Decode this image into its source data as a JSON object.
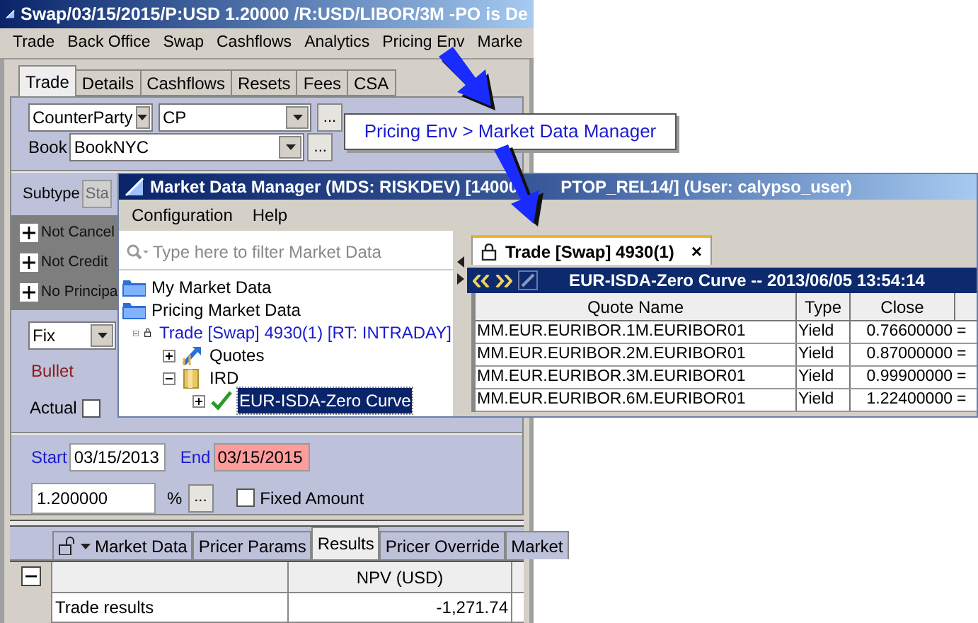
{
  "main_window": {
    "title": "Swap/03/15/2015/P:USD 1.20000 /R:USD/LIBOR/3M  -PO is De",
    "menu": [
      "Trade",
      "Back Office",
      "Swap",
      "Cashflows",
      "Analytics",
      "Pricing Env",
      "Marke"
    ],
    "tabs": [
      {
        "label": "Trade",
        "selected": true
      },
      {
        "label": "Details",
        "selected": false
      },
      {
        "label": "Cashflows",
        "selected": false
      },
      {
        "label": "Resets",
        "selected": false
      },
      {
        "label": "Fees",
        "selected": false
      },
      {
        "label": "CSA",
        "selected": false
      }
    ],
    "counterparty": {
      "role": "CounterParty",
      "value": "CP",
      "button": "..."
    },
    "book": {
      "label": "Book",
      "value": "BookNYC",
      "button": "..."
    },
    "subtype": {
      "label": "Subtype",
      "value": "Sta",
      "disabled": true
    },
    "flags": [
      "Not Cancel",
      "Not Credit",
      "No Principa"
    ],
    "leg_type": "Fix",
    "amortization": "Bullet",
    "actual": {
      "label": "Actual",
      "checked": false
    },
    "start": {
      "label": "Start",
      "value": "03/15/2013",
      "highlighted": false
    },
    "end": {
      "label": "End",
      "value": "03/15/2015",
      "highlighted": true
    },
    "rate": {
      "value": "1.200000",
      "unit": "%",
      "button": "..."
    },
    "fixed_amount": {
      "label": "Fixed Amount",
      "checked": false
    },
    "pricer_tabs": [
      {
        "label": "Market Data",
        "kind": "dropdown",
        "selected": false
      },
      {
        "label": "Pricer Params",
        "kind": "tab",
        "selected": false
      },
      {
        "label": "Results",
        "kind": "tab",
        "selected": true
      },
      {
        "label": "Pricer Override",
        "kind": "tab",
        "selected": false
      },
      {
        "label": "Market",
        "kind": "tab",
        "selected": false
      }
    ],
    "results": {
      "columns": [
        "NPV (USD)"
      ],
      "rows": [
        {
          "label": "Trade results",
          "values": [
            "-1,271.74"
          ]
        }
      ]
    }
  },
  "callout": {
    "text": "Pricing Env > Market Data Manager"
  },
  "mdm_window": {
    "title_start": "Market Data Manager (MDS: RISKDEV) [14000",
    "title_end": "PTOP_REL14/] (User: calypso_user)",
    "menu": [
      "Configuration",
      "Help"
    ],
    "filter": {
      "placeholder": "Type here to filter Market Data"
    },
    "tree": [
      {
        "label": "My Market Data",
        "kind": "folder"
      },
      {
        "label": "Pricing Market Data",
        "kind": "folder",
        "children": [
          {
            "label": "Trade [Swap] 4930(1)  [RT: INTRADAY]",
            "kind": "trade",
            "expanded": true,
            "selected": false,
            "children": [
              {
                "label": "Quotes",
                "kind": "quotes",
                "expanded": false,
                "selected": false
              },
              {
                "label": "IRD",
                "kind": "ird",
                "expanded": true,
                "selected": false,
                "children": [
                  {
                    "label": "EUR-ISDA-Zero Curve",
                    "kind": "curve",
                    "expanded": false,
                    "selected": true
                  }
                ]
              }
            ]
          }
        ]
      }
    ],
    "tab": {
      "label": "Trade [Swap] 4930(1)",
      "close": "×"
    },
    "curve_header": "EUR-ISDA-Zero Curve -- 2013/06/05 13:54:14",
    "table": {
      "columns": [
        "Quote Name",
        "Type",
        "Close"
      ],
      "rows": [
        {
          "name": "MM.EUR.EURIBOR.1M.EURIBOR01",
          "type": "Yield",
          "close": "0.76600000",
          "column_4": "="
        },
        {
          "name": "MM.EUR.EURIBOR.2M.EURIBOR01",
          "type": "Yield",
          "close": "0.87000000",
          "column_4": "="
        },
        {
          "name": "MM.EUR.EURIBOR.3M.EURIBOR01",
          "type": "Yield",
          "close": "0.99900000",
          "column_4": "="
        },
        {
          "name": "MM.EUR.EURIBOR.6M.EURIBOR01",
          "type": "Yield",
          "close": "1.22400000",
          "column_4": "="
        }
      ]
    }
  }
}
